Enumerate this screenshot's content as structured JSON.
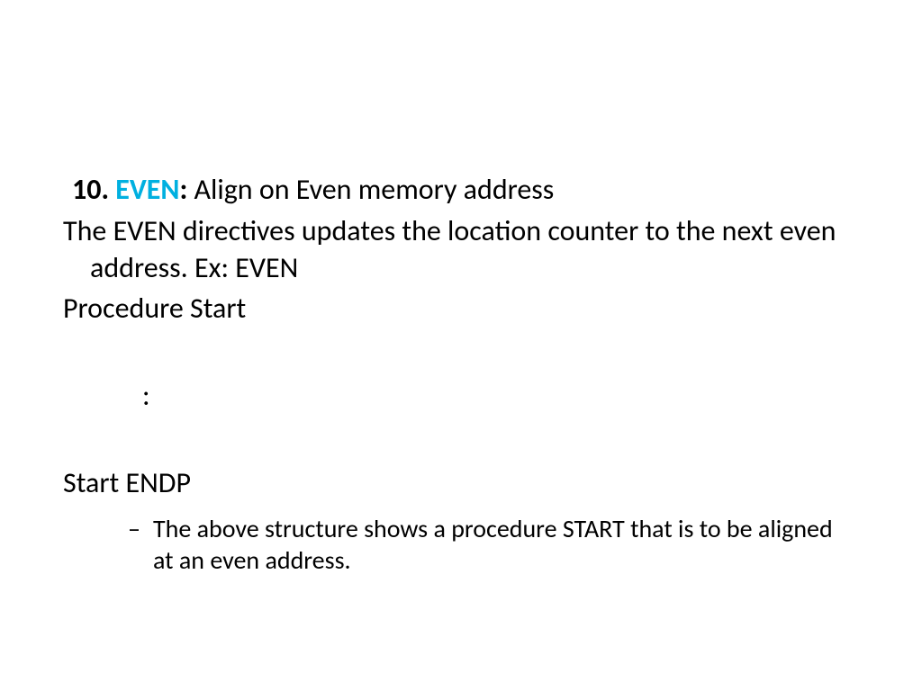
{
  "heading": {
    "number": "10.",
    "keyword": "EVEN",
    "colon": ":",
    "rest": " Align on Even memory address"
  },
  "desc": "The EVEN directives updates the location counter to the next even address. Ex: EVEN",
  "procStart": "Procedure Start",
  "colonLine": ":",
  "startEndp": "Start ENDP",
  "bullet": {
    "dash": "–",
    "text": "The above structure shows a procedure START that is to be aligned at an even address."
  }
}
